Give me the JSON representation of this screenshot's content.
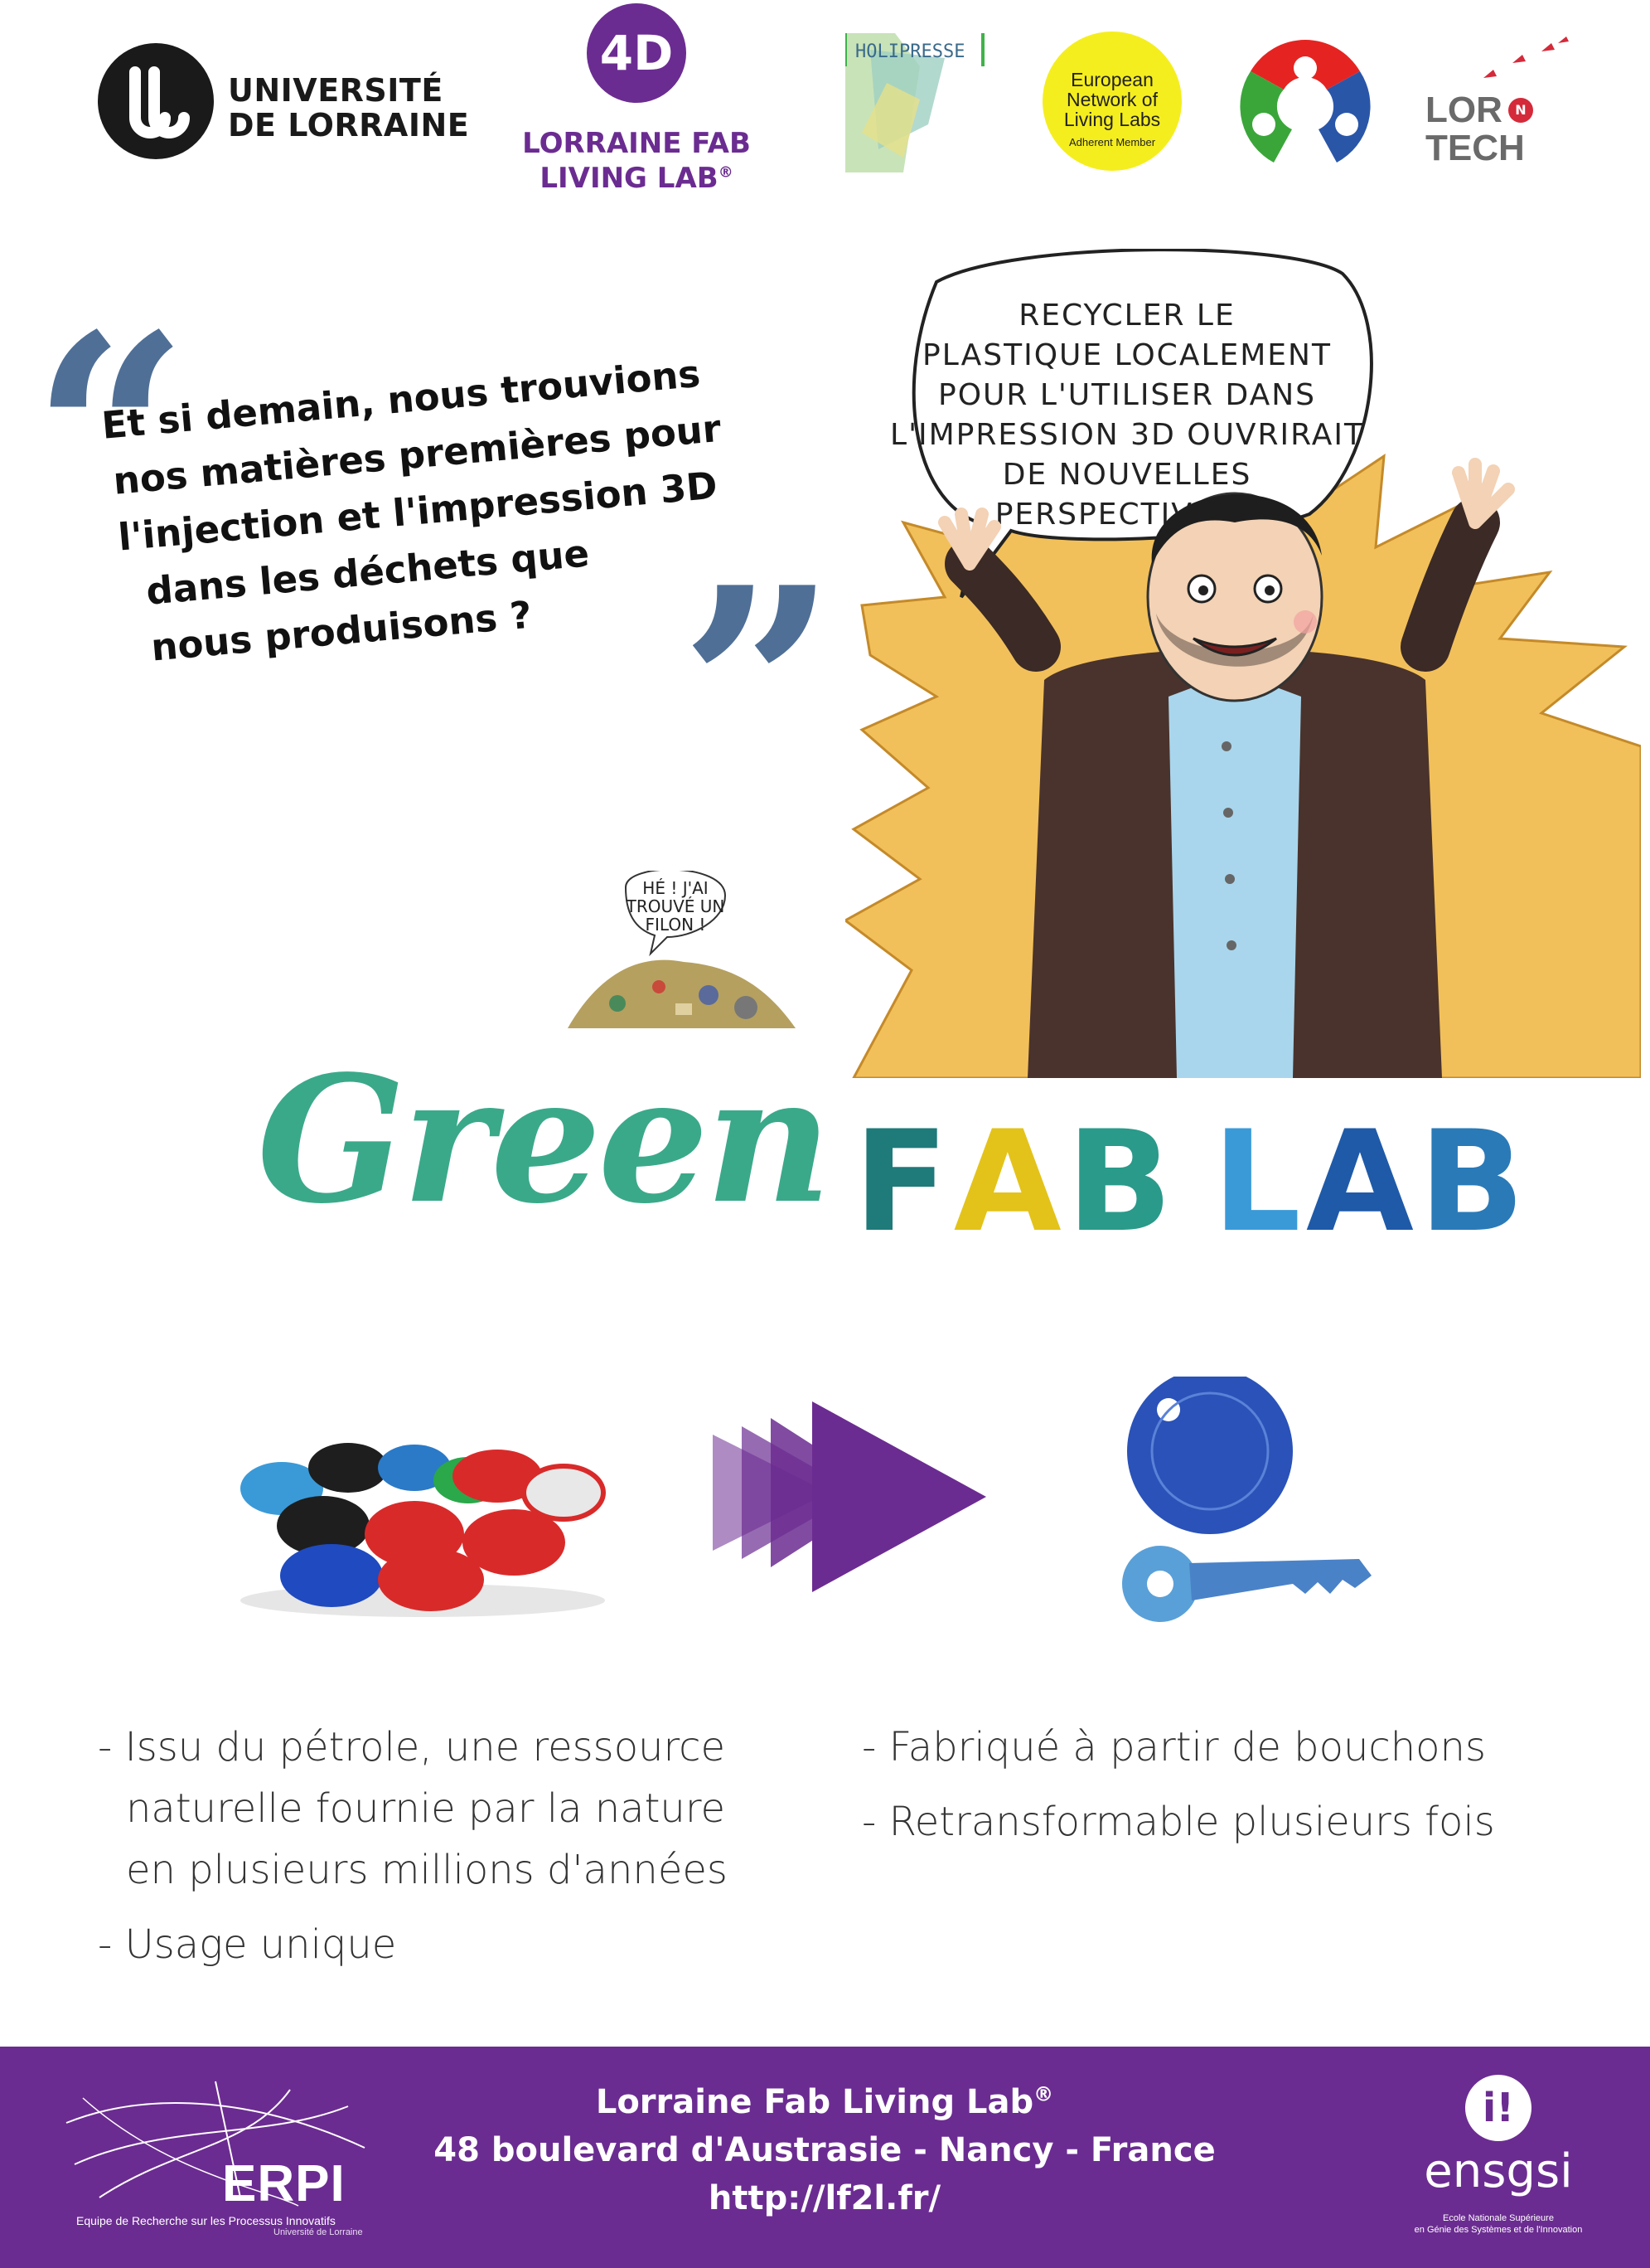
{
  "logos": {
    "univ_lorraine": {
      "icon": "ul-monogram-icon",
      "line1": "UNIVERSITÉ",
      "line2": "DE LORRAINE"
    },
    "fablab_4d": {
      "mark": "4D",
      "line1": "LORRAINE FAB",
      "line2": "LIVING LAB",
      "reg": "®"
    },
    "holipresse": {
      "text": "HOLIPRESSE"
    },
    "enoll": {
      "line1": "European",
      "line2": "Network of",
      "line3": "Living Labs",
      "sub": "Adherent Member"
    },
    "fab_foundation": {
      "icon": "fab-foundation-icon"
    },
    "lorntech": {
      "line1": "LOR",
      "n": "N",
      "line2": "TECH",
      "icon": "birds-icon"
    }
  },
  "quote": {
    "lines": [
      "Et si demain, nous trouvions",
      "nos matières premières pour",
      "l'injection et l'impression 3D",
      "dans les déchets que",
      "nous produisons ?"
    ]
  },
  "comic": {
    "speech_lines": [
      "RECYCLER LE",
      "PLASTIQUE LOCALEMENT",
      "POUR L'UTILISER DANS",
      "L'IMPRESSION 3D OUVRIRAIT",
      "DE NOUVELLES",
      "PERSPECTIVES !"
    ],
    "small_speech_lines": [
      "HÉ ! J'AI",
      "TROUVÉ UN",
      "FILON !"
    ]
  },
  "title": {
    "green": "Green",
    "fab_letters": [
      "F",
      "A",
      "B"
    ],
    "lab_letters": [
      "L",
      "A",
      "B"
    ]
  },
  "lists": {
    "left": {
      "item1": [
        "- Issu du pétrole, une ressource",
        "naturelle fournie par la nature",
        "en plusieurs millions d'années"
      ],
      "item2": "- Usage unique"
    },
    "right": {
      "item1": "- Fabriqué à partir de bouchons",
      "item2": "- Retransformable plusieurs fois"
    }
  },
  "footer": {
    "erpi": {
      "text": "ERPI",
      "sub": "Equipe de Recherche sur les Processus Innovatifs",
      "sub2": "Université de Lorraine"
    },
    "address": {
      "line1": "Lorraine Fab Living Lab",
      "reg": "®",
      "line2": "48 boulevard d'Austrasie - Nancy - France",
      "line3": "http://lf2l.fr/"
    },
    "ensgsi": {
      "mark": "i!",
      "text": "ensgsi",
      "sub1": "Ecole Nationale Supérieure",
      "sub2": "en Génie des Systèmes et de l'Innovation"
    }
  },
  "colors": {
    "purple": "#6b2c91",
    "green": "#3aa98a",
    "quote_blue": "#4f6f96",
    "burst": "#f2c05a"
  }
}
